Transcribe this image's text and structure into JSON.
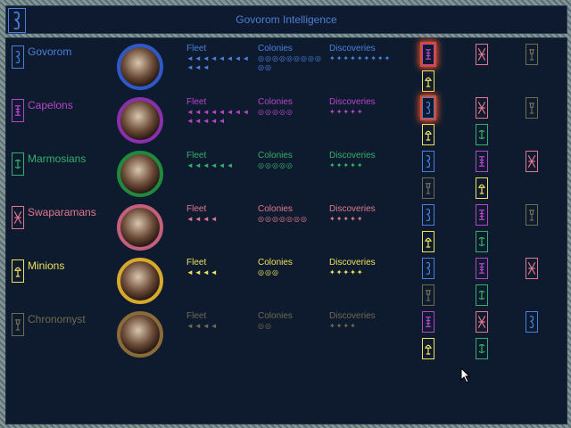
{
  "window": {
    "title": "Govorom Intelligence",
    "title_icon": "govorom-glyph-icon"
  },
  "labels": {
    "fleet": "Fleet",
    "colonies": "Colonies",
    "discoveries": "Discoveries"
  },
  "colors": {
    "govorom": "#4a7fe0",
    "capelons": "#b546c9",
    "marmosians": "#34b06a",
    "swaparamans": "#e07891",
    "minions": "#efe05b",
    "chronomyst": "#6f6a52"
  },
  "races": [
    {
      "key": "govorom",
      "name": "Govorom",
      "color": "#4a7fe0",
      "portrait_ring": "#2f59c9",
      "fleet": "◄◄◄◄◄◄◄◄◄◄◄",
      "colonies": "◎◎◎◎◎◎◎◎◎◎◎",
      "discoveries": "✦✦✦✦✦✦✦✦✦",
      "relations": [
        {
          "glyph": "capelons",
          "color": "#b546c9",
          "attention": true
        },
        {
          "glyph": "swaparamans",
          "color": "#e07891",
          "attention": false
        },
        {
          "glyph": "chronomyst",
          "color": "#6f6a52",
          "attention": false
        },
        {
          "glyph": "minions",
          "color": "#efe05b",
          "attention": false
        }
      ]
    },
    {
      "key": "capelons",
      "name": "Capelons",
      "color": "#b546c9",
      "portrait_ring": "#8a2fae",
      "fleet": "◄◄◄◄◄◄◄◄◄◄◄◄◄",
      "colonies": "◎◎◎◎◎",
      "discoveries": "✦✦✦✦✦",
      "relations": [
        {
          "glyph": "govorom",
          "color": "#4a7fe0",
          "attention": true
        },
        {
          "glyph": "swaparamans",
          "color": "#e07891",
          "attention": false
        },
        {
          "glyph": "chronomyst",
          "color": "#6f6a52",
          "attention": false
        },
        {
          "glyph": "minions",
          "color": "#efe05b",
          "attention": false
        },
        {
          "glyph": "marmosians",
          "color": "#34b06a",
          "attention": false
        }
      ]
    },
    {
      "key": "marmosians",
      "name": "Marmosians",
      "color": "#34b06a",
      "portrait_ring": "#1f8a3c",
      "fleet": "◄◄◄◄◄◄",
      "colonies": "◎◎◎◎◎",
      "discoveries": "✦✦✦✦✦",
      "relations": [
        {
          "glyph": "govorom",
          "color": "#4a7fe0",
          "attention": false
        },
        {
          "glyph": "capelons",
          "color": "#b546c9",
          "attention": false
        },
        {
          "glyph": "swaparamans",
          "color": "#e07891",
          "attention": false
        },
        {
          "glyph": "chronomyst",
          "color": "#6f6a52",
          "attention": false
        },
        {
          "glyph": "minions",
          "color": "#efe05b",
          "attention": false
        }
      ]
    },
    {
      "key": "swaparamans",
      "name": "Swaparamans",
      "color": "#e07891",
      "portrait_ring": "#c45f7d",
      "fleet": "◄◄◄◄",
      "colonies": "◎◎◎◎◎◎◎",
      "discoveries": "✦✦✦✦✦",
      "relations": [
        {
          "glyph": "govorom",
          "color": "#4a7fe0",
          "attention": false
        },
        {
          "glyph": "capelons",
          "color": "#b546c9",
          "attention": false
        },
        {
          "glyph": "chronomyst",
          "color": "#6f6a52",
          "attention": false
        },
        {
          "glyph": "minions",
          "color": "#efe05b",
          "attention": false
        },
        {
          "glyph": "marmosians",
          "color": "#34b06a",
          "attention": false
        }
      ]
    },
    {
      "key": "minions",
      "name": "Minions",
      "color": "#efe05b",
      "portrait_ring": "#d6a92a",
      "fleet": "◄◄◄◄",
      "colonies": "◎◎◎",
      "discoveries": "✦✦✦✦✦",
      "relations": [
        {
          "glyph": "govorom",
          "color": "#4a7fe0",
          "attention": false
        },
        {
          "glyph": "capelons",
          "color": "#b546c9",
          "attention": false
        },
        {
          "glyph": "swaparamans",
          "color": "#e07891",
          "attention": false
        },
        {
          "glyph": "chronomyst",
          "color": "#6f6a52",
          "attention": false
        },
        {
          "glyph": "marmosians",
          "color": "#34b06a",
          "attention": false
        }
      ]
    },
    {
      "key": "chronomyst",
      "name": "Chronomyst",
      "color": "#6f6a52",
      "portrait_ring": "#8a6c3a",
      "fleet": "◄◄◄◄",
      "colonies": "◎◎",
      "discoveries": "✦✦✦✦",
      "relations": [
        {
          "glyph": "capelons",
          "color": "#b546c9",
          "attention": false
        },
        {
          "glyph": "swaparamans",
          "color": "#e07891",
          "attention": false
        },
        {
          "glyph": "govorom",
          "color": "#4a7fe0",
          "attention": false
        },
        {
          "glyph": "minions",
          "color": "#efe05b",
          "attention": false
        },
        {
          "glyph": "marmosians",
          "color": "#34b06a",
          "attention": false
        }
      ]
    }
  ]
}
